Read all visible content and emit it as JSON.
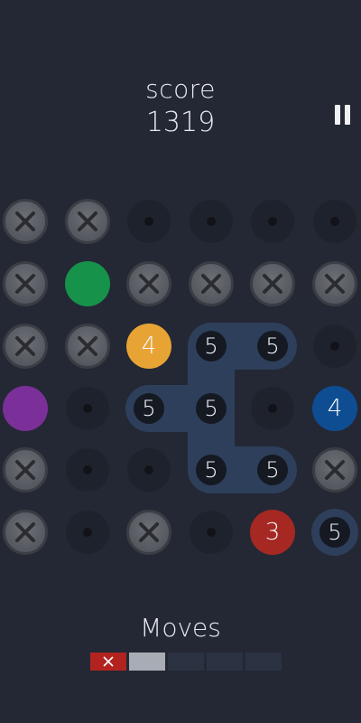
{
  "header": {
    "score_label": "score",
    "score_value": "1319",
    "pause_icon": "pause-icon"
  },
  "board": {
    "rows": 6,
    "cols": 6,
    "cells": [
      [
        "blocked",
        "blocked",
        "empty",
        "empty",
        "empty",
        "empty"
      ],
      [
        "blocked",
        "green",
        "blocked",
        "blocked",
        "blocked",
        "blocked"
      ],
      [
        "blocked",
        "blocked",
        "orange:4",
        "sel:5",
        "sel:5",
        "empty"
      ],
      [
        "purple",
        "empty",
        "sel:5",
        "sel:5",
        "empty",
        "blue:4"
      ],
      [
        "blocked",
        "empty",
        "empty",
        "sel:5",
        "sel:5",
        "blocked"
      ],
      [
        "blocked",
        "empty",
        "blocked",
        "empty",
        "red:3",
        "ring:5"
      ]
    ],
    "colors": {
      "green": "#17924a",
      "orange": "#e8a335",
      "purple": "#7b2f98",
      "blue": "#0f4d93",
      "red": "#a52823",
      "highlight": "#2e3f5b",
      "background": "#232834"
    }
  },
  "footer": {
    "moves_label": "Moves",
    "moves": [
      "failed",
      "used",
      "empty",
      "empty",
      "empty"
    ]
  }
}
